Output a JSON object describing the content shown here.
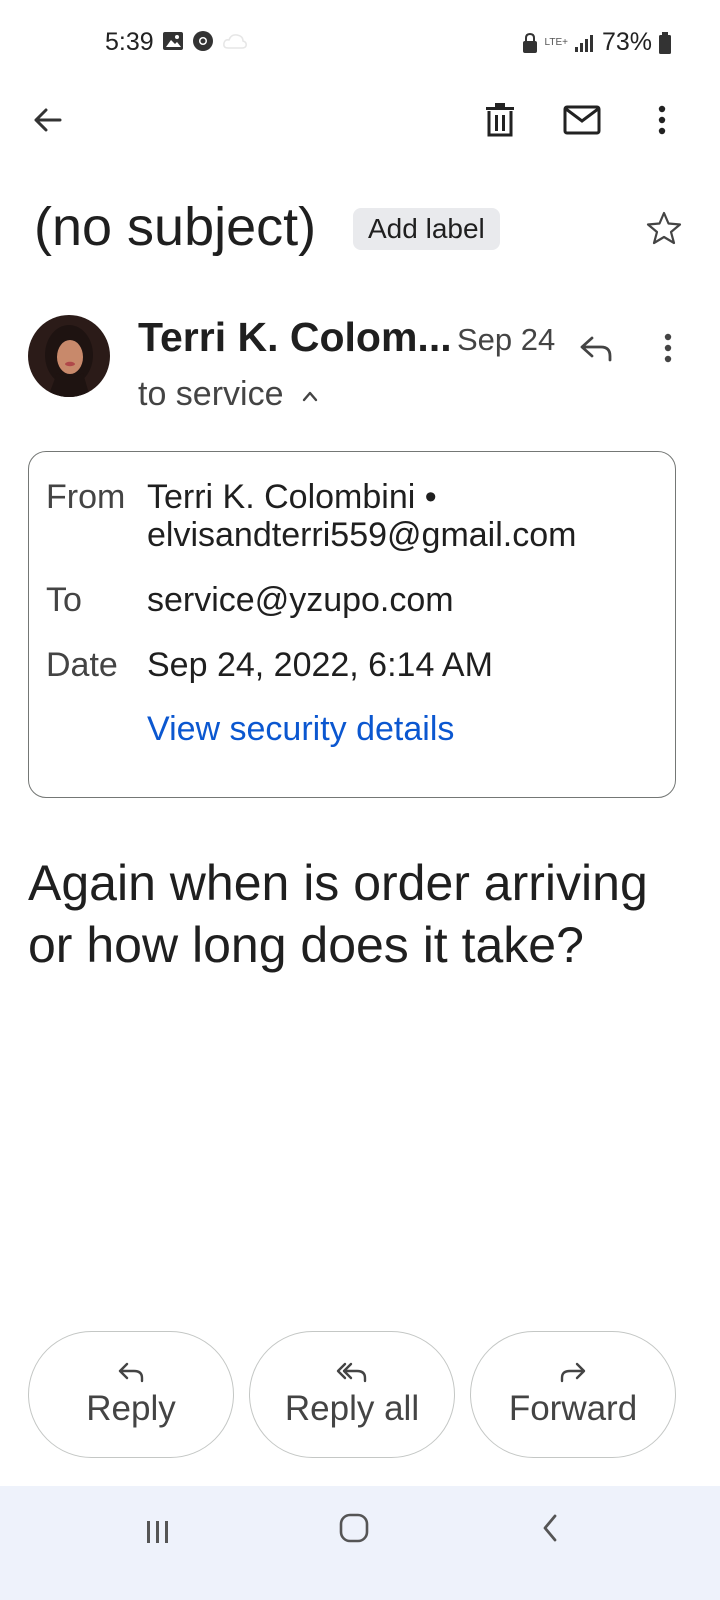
{
  "status_bar": {
    "time": "5:39",
    "network": "LTE+",
    "battery": "73%"
  },
  "toolbar": {
    "back_icon": "arrow-left-icon",
    "delete_icon": "trash-icon",
    "mark_unread_icon": "mail-icon",
    "more_icon": "more-vert-icon"
  },
  "email": {
    "subject": "(no subject)",
    "add_label": "Add label",
    "sender_short": "Terri K. Colom...",
    "date_short": "Sep 24",
    "to_line": "to service",
    "details": {
      "from_label": "From",
      "from_name": "Terri K. Colombini •",
      "from_email": "elvisandterri559@gmail.com",
      "to_label": "To",
      "to_value": "service@yzupo.com",
      "date_label": "Date",
      "date_value": "Sep 24, 2022, 6:14 AM",
      "security_link": "View security details"
    },
    "body": "Again when is order arriving or how long does it take?"
  },
  "actions": {
    "reply": "Reply",
    "reply_all": "Reply all",
    "forward": "Forward"
  },
  "colors": {
    "link": "#0b57d0",
    "nav_bar_bg": "#eef2fb",
    "chip_bg": "#e9eaed"
  }
}
